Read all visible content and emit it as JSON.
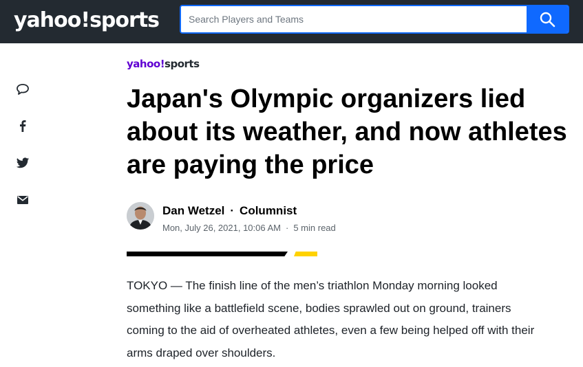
{
  "header": {
    "brand_left": "yahoo",
    "brand_excl": "!",
    "brand_right": "sports",
    "search_placeholder": "Search Players and Teams",
    "search_icon": "search-icon"
  },
  "share": {
    "items": [
      {
        "icon": "comment-icon"
      },
      {
        "icon": "facebook-icon"
      },
      {
        "icon": "twitter-icon"
      },
      {
        "icon": "mail-icon"
      }
    ]
  },
  "article": {
    "publisher_left": "yahoo",
    "publisher_excl": "!",
    "publisher_right": "sports",
    "headline": "Japan's Olympic organizers lied about its weather, and now athletes are paying the price",
    "author_name": "Dan Wetzel",
    "author_sep": "·",
    "author_role": "Columnist",
    "date": "Mon, July 26, 2021, 10:06 AM",
    "meta_sep": "·",
    "read_time": "5 min read",
    "body": "TOKYO — The finish line of the men’s triathlon Monday morning looked something like a battlefield scene, bodies sprawled out on ground, trainers coming to the aid of overheated athletes, even a few being helped off with their arms draped over shoulders."
  },
  "colors": {
    "topbar": "#232a31",
    "search_accent": "#0f69ff",
    "publisher_purple": "#6001d2",
    "rule_yellow": "#ffd200"
  }
}
